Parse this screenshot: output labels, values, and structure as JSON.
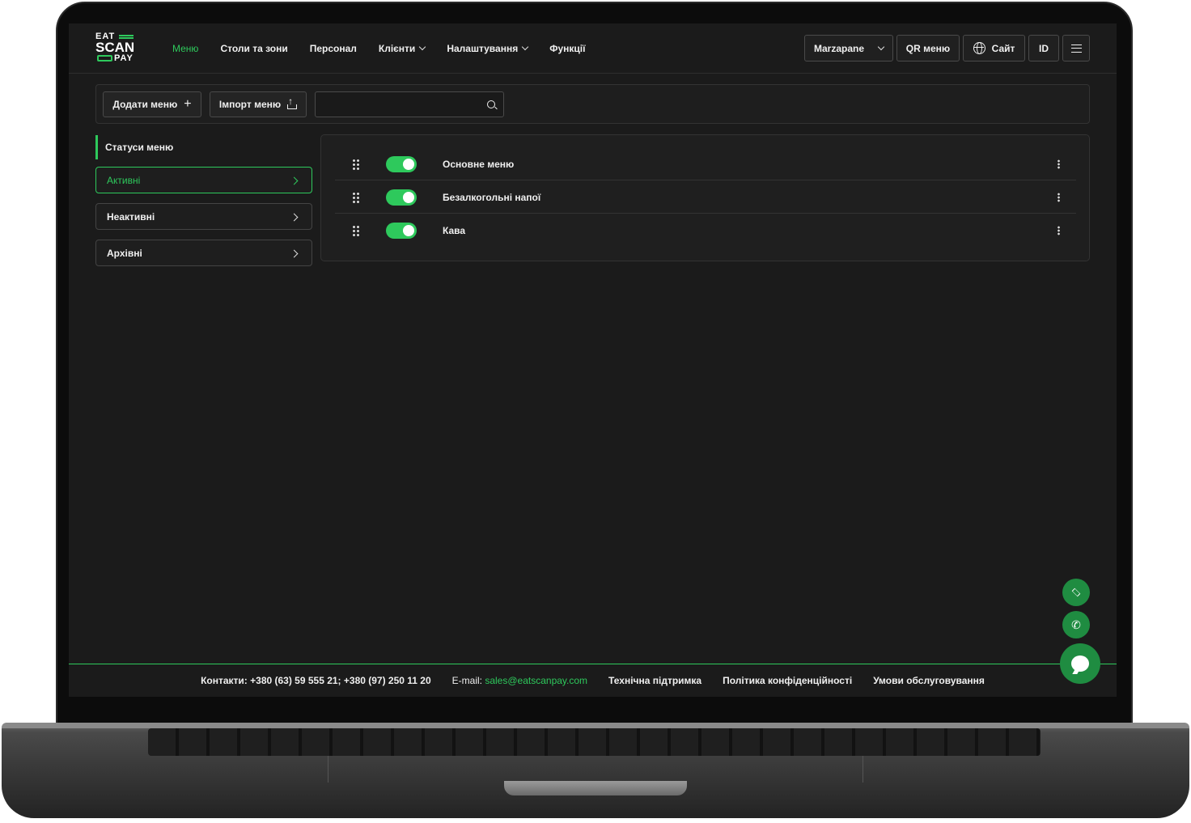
{
  "logo": {
    "line1": "EAT",
    "line2": "SCAN",
    "line3": "PAY"
  },
  "nav": [
    {
      "label": "Меню",
      "active": true
    },
    {
      "label": "Столи та зони"
    },
    {
      "label": "Персонал"
    },
    {
      "label": "Клієнти",
      "dropdown": true
    },
    {
      "label": "Налаштування",
      "dropdown": true
    },
    {
      "label": "Функції"
    }
  ],
  "header_right": {
    "venue": "Marzapane",
    "qr_menu": "QR меню",
    "site": "Сайт",
    "id": "ID"
  },
  "toolbar": {
    "add_menu": "Додати меню",
    "import_menu": "Імпорт меню",
    "search_placeholder": ""
  },
  "sidebar": {
    "title": "Статуси меню",
    "items": [
      {
        "label": "Активні",
        "active": true
      },
      {
        "label": "Неактивні"
      },
      {
        "label": "Архівні"
      }
    ]
  },
  "menus": [
    {
      "name": "Основне меню",
      "enabled": true
    },
    {
      "name": "Безалкогольні напої",
      "enabled": true
    },
    {
      "name": "Кава",
      "enabled": true
    }
  ],
  "footer": {
    "contacts": "Контакти: +380 (63) 59 555 21; +380 (97) 250 11 20",
    "email_label": "E-mail:",
    "email": "sales@eatscanpay.com",
    "support": "Технічна підтримка",
    "privacy": "Політика конфіденційності",
    "terms": "Умови обслуговування"
  },
  "colors": {
    "accent": "#2ec95c",
    "background": "#1b1b1b",
    "fab": "#1f8c41"
  },
  "icons": {
    "fab1": "graduation-cap-icon",
    "fab2": "phone-icon",
    "fab3": "chat-bubble-icon"
  }
}
